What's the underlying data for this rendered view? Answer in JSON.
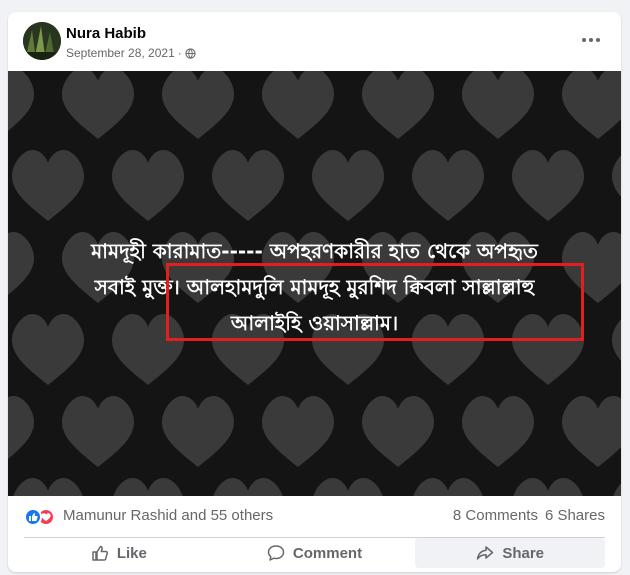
{
  "post": {
    "author": "Nura Habib",
    "date": "September 28, 2021",
    "separator": "·",
    "privacy_icon": "globe-icon"
  },
  "photo": {
    "caption_line1": "মামদূহী কারামাত----- অপহরণকারীর হাত থেকে অপহৃত",
    "caption_line2": "সবাই মুক্ত। আলহামদুলি মামদূহ মুরশিদ ক্বিবলা সাল্লাল্লাহু",
    "caption_line3": "আলাইহি ওয়াসাল্লাম।",
    "background_color": "#141414",
    "heart_color": "#3a3a3a",
    "highlight_color": "#e41e1e"
  },
  "stats": {
    "reaction_icons": [
      "like-icon",
      "love-icon"
    ],
    "reacted_by": "Mamunur Rashid and 55 others",
    "comments": "8 Comments",
    "shares": "6 Shares"
  },
  "actions": {
    "like": "Like",
    "comment": "Comment",
    "share": "Share"
  }
}
